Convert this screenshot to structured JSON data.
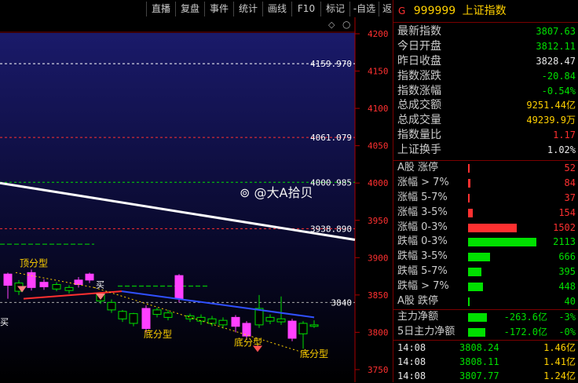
{
  "toolbar": {
    "items": [
      "直播",
      "复盘",
      "事件",
      "统计",
      "画线",
      "F10",
      "标记",
      "-自选",
      "返回"
    ]
  },
  "chart": {
    "price_axis_ticks": [
      "4200",
      "4150",
      "4100",
      "4050",
      "4000",
      "3950",
      "3900",
      "3850",
      "3800",
      "3750"
    ],
    "hline_labels": [
      "4159.970",
      "4061.079",
      "4000.985",
      "3938.890",
      "3840"
    ],
    "annotations": {
      "top_pattern": "顶分型",
      "bottom_pattern_1": "底分型",
      "bottom_pattern_2": "底分型",
      "bottom_pattern_3": "底分型",
      "buy_mark_left": "买",
      "buy_mark_mid": "买"
    },
    "icons": [
      "diamond-icon",
      "ring-icon"
    ],
    "watermark": "@大A拾贝"
  },
  "panel": {
    "g_label": "G",
    "code": "999999",
    "name": "上证指数",
    "stats": [
      {
        "label": "最新指数",
        "value": "3807.63",
        "color": "#00e000"
      },
      {
        "label": "今日开盘",
        "value": "3812.11",
        "color": "#00e000"
      },
      {
        "label": "昨日收盘",
        "value": "3828.47",
        "color": "#e8e8e8"
      },
      {
        "label": "指数涨跌",
        "value": "-20.84",
        "color": "#00e000"
      },
      {
        "label": "指数涨幅",
        "value": "-0.54%",
        "color": "#00e000"
      },
      {
        "label": "总成交额",
        "value": "9251.44亿",
        "color": "#ffd000"
      },
      {
        "label": "总成交量",
        "value": "49239.9万",
        "color": "#ffd000"
      },
      {
        "label": "指数量比",
        "value": "1.17",
        "color": "#ff3030"
      },
      {
        "label": "上证换手",
        "value": "1.02%",
        "color": "#e8e8e8"
      }
    ],
    "breadth": [
      {
        "label": "A股 涨停",
        "value": "52",
        "color": "#ff3030",
        "bar": "#ff3030",
        "fraction": 0.01
      },
      {
        "label": "涨幅 > 7%",
        "value": "84",
        "color": "#ff3030",
        "bar": "#ff3030",
        "fraction": 0.03
      },
      {
        "label": "涨幅 5-7%",
        "value": "37",
        "color": "#ff3030",
        "bar": "#ff3030",
        "fraction": 0.01
      },
      {
        "label": "涨幅 3-5%",
        "value": "154",
        "color": "#ff3030",
        "bar": "#ff3030",
        "fraction": 0.05
      },
      {
        "label": "涨幅 0-3%",
        "value": "1502",
        "color": "#ff3030",
        "bar": "#ff3030",
        "fraction": 0.56
      },
      {
        "label": "跌幅 0-3%",
        "value": "2113",
        "color": "#00e000",
        "bar": "#00e000",
        "fraction": 0.79
      },
      {
        "label": "跌幅 3-5%",
        "value": "666",
        "color": "#00e000",
        "bar": "#00e000",
        "fraction": 0.25
      },
      {
        "label": "跌幅 5-7%",
        "value": "395",
        "color": "#00e000",
        "bar": "#00e000",
        "fraction": 0.15
      },
      {
        "label": "跌幅 > 7%",
        "value": "448",
        "color": "#00e000",
        "bar": "#00e000",
        "fraction": 0.17
      },
      {
        "label": "A股 跌停",
        "value": "40",
        "color": "#00e000",
        "bar": "#00e000",
        "fraction": 0.01
      }
    ],
    "capital": [
      {
        "label": "主力净额",
        "value": "-263.6亿",
        "pct": "-3%",
        "fraction": 0.22
      },
      {
        "label": "5日主力净额",
        "value": "-172.0亿",
        "pct": "-0%",
        "fraction": 0.2
      }
    ],
    "ticks": [
      {
        "time": "14:08",
        "price": "3808.24",
        "vol": "1.46亿"
      },
      {
        "time": "14:08",
        "price": "3808.11",
        "vol": "1.41亿"
      },
      {
        "time": "14:08",
        "price": "3807.77",
        "vol": "1.24亿"
      }
    ]
  }
}
